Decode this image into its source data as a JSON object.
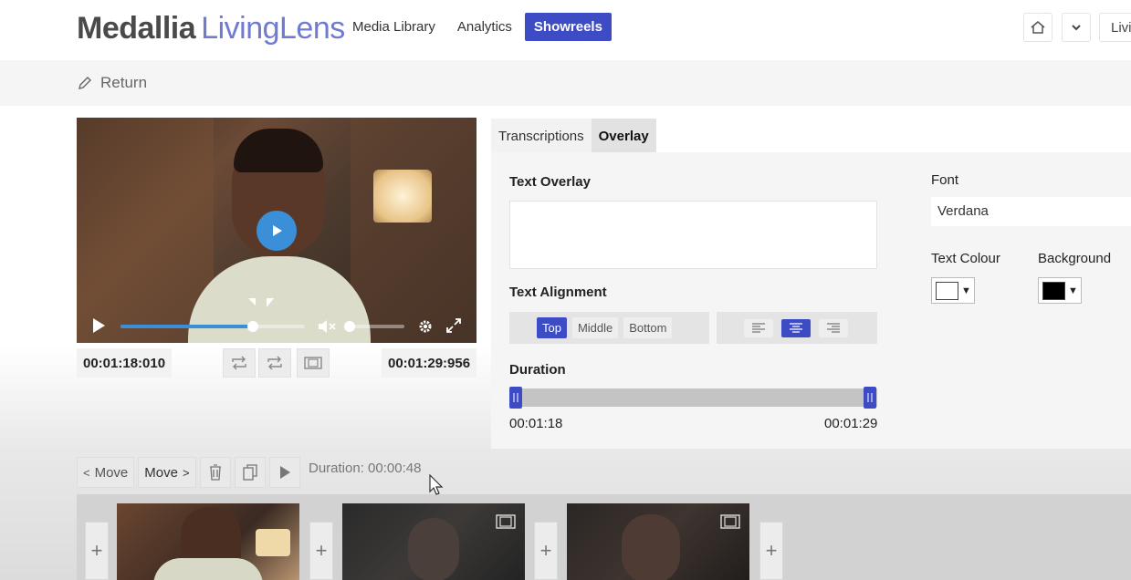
{
  "header": {
    "logo_brand": "Medallia",
    "logo_product": "LivingLens",
    "nav": [
      {
        "label": "Media Library",
        "active": false
      },
      {
        "label": "Analytics",
        "active": false
      },
      {
        "label": "Showreels",
        "active": true
      }
    ],
    "user_button_label": "Livi",
    "accent_color": "#3d4cc4"
  },
  "subbar": {
    "return_label": "Return"
  },
  "player": {
    "current_time": "00:01:18:010",
    "end_time": "00:01:29:956",
    "progress_fraction": 0.72,
    "volume_fraction": 0.0
  },
  "tabs": [
    {
      "label": "Transcriptions",
      "active": false
    },
    {
      "label": "Overlay",
      "active": true
    }
  ],
  "overlay": {
    "text_overlay_label": "Text Overlay",
    "text_overlay_value": "",
    "text_alignment_label": "Text Alignment",
    "vertical_options": [
      {
        "label": "Top",
        "selected": true
      },
      {
        "label": "Middle",
        "selected": false
      },
      {
        "label": "Bottom",
        "selected": false
      }
    ],
    "horizontal_selected": "center",
    "duration_label": "Duration",
    "duration_start": "00:01:18",
    "duration_end": "00:01:29",
    "font_label": "Font",
    "font_value": "Verdana",
    "text_colour_label": "Text Colour",
    "text_colour": "#ffffff",
    "background_label": "Background",
    "background_colour": "#000000"
  },
  "timeline": {
    "move_left_label": "Move",
    "move_right_label": "Move",
    "duration_text": "Duration: 00:00:48",
    "clip_count": 3
  }
}
